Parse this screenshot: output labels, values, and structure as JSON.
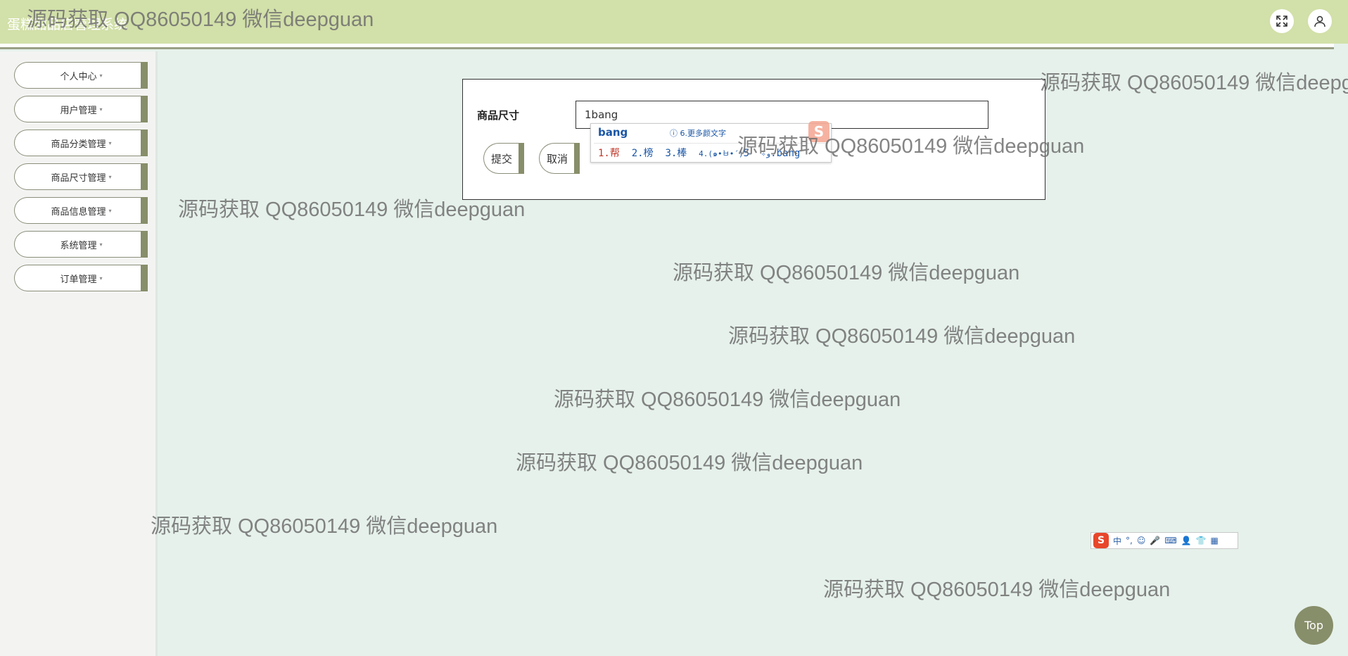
{
  "header": {
    "title": "蛋糕甜品店管理系统",
    "fullscreen_icon": "expand-icon",
    "user_icon": "user-icon"
  },
  "sidebar": {
    "items": [
      {
        "label": "个人中心"
      },
      {
        "label": "用户管理"
      },
      {
        "label": "商品分类管理"
      },
      {
        "label": "商品尺寸管理"
      },
      {
        "label": "商品信息管理"
      },
      {
        "label": "系统管理"
      },
      {
        "label": "订单管理"
      }
    ],
    "caret": "▾"
  },
  "form": {
    "field_label": "商品尺寸",
    "field_value": "1bang",
    "submit_label": "提交",
    "cancel_label": "取消"
  },
  "ime": {
    "composition": "bang",
    "more_hint": "ⓘ 6.更多颜文字",
    "candidates": [
      "1.帮",
      "2.榜",
      "3.棒",
      "4.(๑•̀ㅂ•́)و✧",
      "5.bang"
    ],
    "logo": "S",
    "bar_items": [
      "中",
      "°,",
      "☺",
      "🎤",
      "⌨",
      "👤",
      "👕",
      "▦"
    ]
  },
  "top_button": {
    "label": "Top"
  },
  "watermark": {
    "text": "源码获取 QQ86050149 微信deepguan"
  },
  "colors": {
    "header_bg": "#d2e0a9",
    "accent": "#878e6a",
    "content_bg": "#e6f1eb",
    "sidebar_bg": "#f3f4f2"
  }
}
